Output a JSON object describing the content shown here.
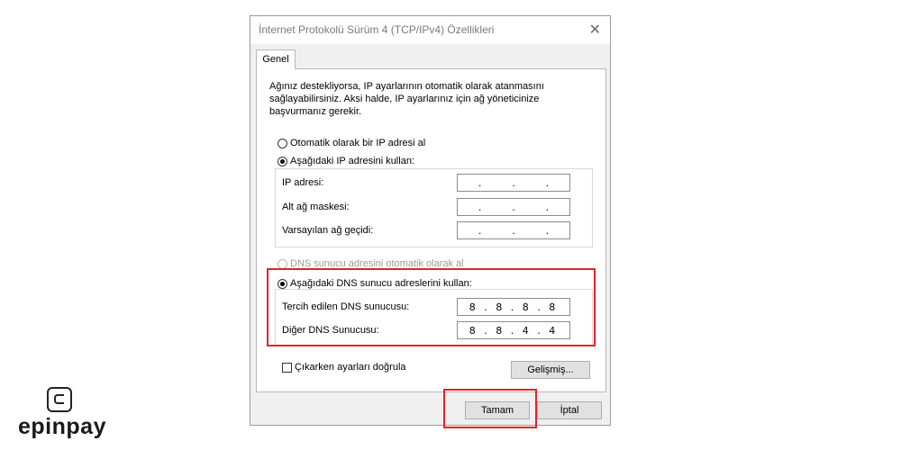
{
  "dialog": {
    "title": "İnternet Protokolü Sürüm 4 (TCP/IPv4) Özellikleri",
    "close_icon": "close-icon",
    "tab_label": "Genel",
    "description": "Ağınız destekliyorsa, IP ayarlarının otomatik olarak atanmasını sağlayabilirsiniz. Aksi halde, IP ayarlarınız için ağ yöneticinize başvurmanız gerekir.",
    "ip_auto_label": "Otomatik olarak bir IP adresi al",
    "ip_manual_label": "Aşağıdaki IP adresini kullan:",
    "ip_fields": [
      {
        "label": "IP adresi:",
        "value": [
          ".",
          ".",
          "."
        ]
      },
      {
        "label": "Alt ağ maskesi:",
        "value": [
          ".",
          ".",
          "."
        ]
      },
      {
        "label": "Varsayılan ağ geçidi:",
        "value": [
          ".",
          ".",
          "."
        ]
      }
    ],
    "dns_auto_label": "DNS sunucu adresini otomatik olarak al",
    "dns_manual_label": "Aşağıdaki DNS sunucu adreslerini kullan:",
    "dns_fields": [
      {
        "label": "Tercih edilen DNS sunucusu:",
        "value": "8 . 8 . 8 . 8"
      },
      {
        "label": "Diğer DNS Sunucusu:",
        "value": "8 . 8 . 4 . 4"
      }
    ],
    "validate_label": "Çıkarken ayarları doğrula",
    "advanced_label": "Gelişmiş...",
    "ok_label": "Tamam",
    "cancel_label": "İptal"
  },
  "colors": {
    "highlight": "#e0242c"
  },
  "logo": {
    "text": "epinpay",
    "icon": "epinpay-logo-icon"
  }
}
